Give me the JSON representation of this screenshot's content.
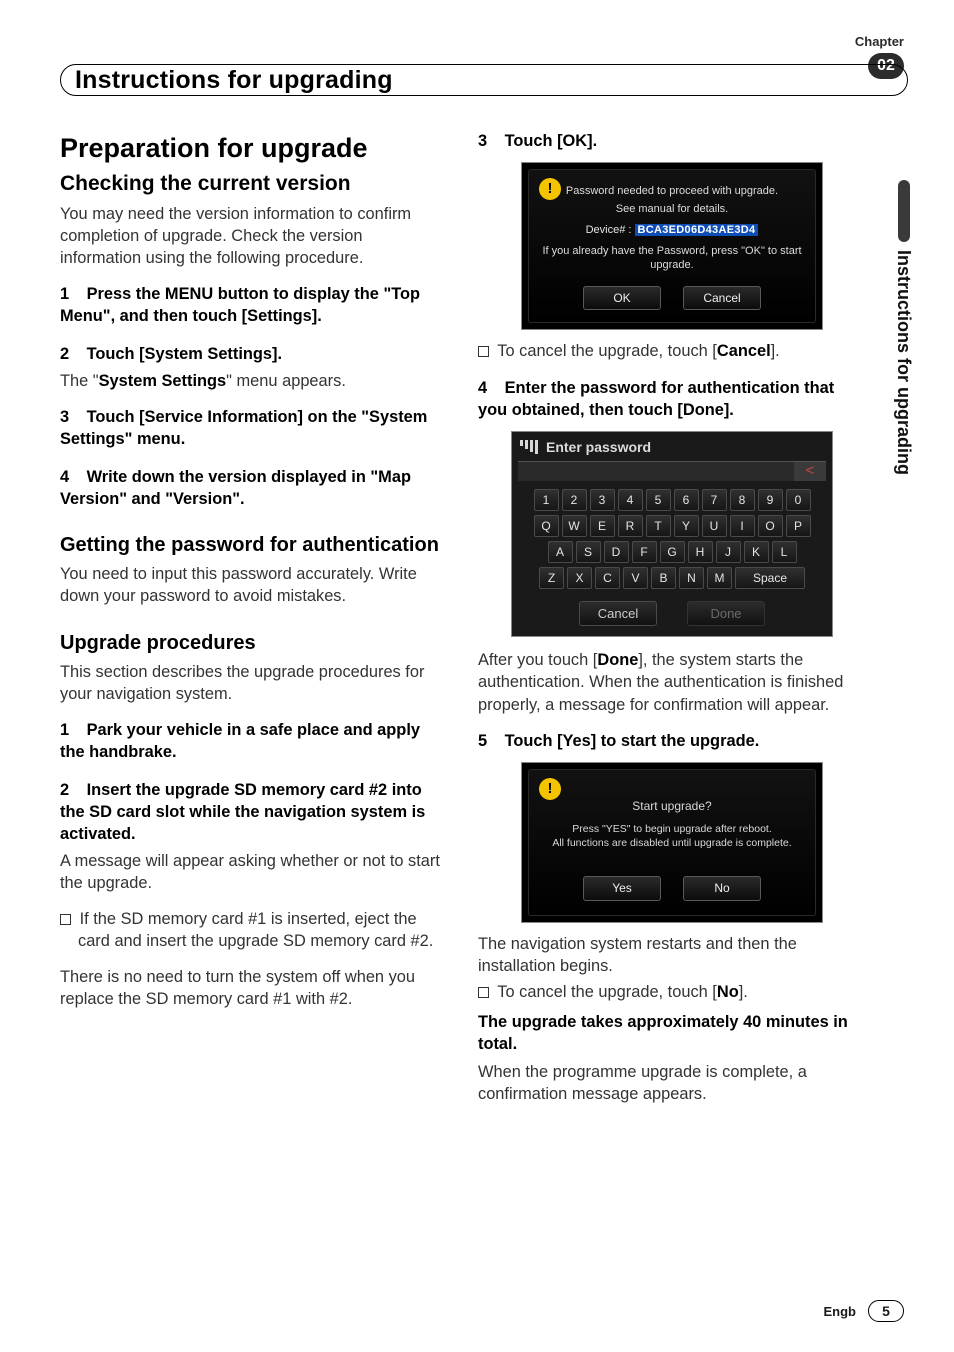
{
  "chapter": {
    "label": "Chapter",
    "number": "02"
  },
  "header": {
    "title": "Instructions for upgrading"
  },
  "sidetab": "Instructions for upgrading",
  "footer": {
    "lang": "Engb",
    "page": "5"
  },
  "left": {
    "h1": "Preparation for upgrade",
    "h2a": "Checking the current version",
    "p1": "You may need the version information to confirm completion of upgrade. Check the version information using the following procedure.",
    "s1_num": "1",
    "s1_txt": "Press the MENU button to display the \"Top Menu\", and then touch [Settings].",
    "s2_num": "2",
    "s2_txt": "Touch [System Settings].",
    "s2_body_a": "The \"",
    "s2_body_b": "System Settings",
    "s2_body_c": "\" menu appears.",
    "s3_num": "3",
    "s3_txt": "Touch [Service Information] on the \"System Settings\" menu.",
    "s4_num": "4",
    "s4_txt": "Write down the version displayed in \"Map Version\" and \"Version\".",
    "h2b": "Getting the password for authentication",
    "p2": "You need to input this password accurately. Write down your password to avoid mistakes.",
    "h2c": "Upgrade procedures",
    "p3": "This section describes the upgrade procedures for your navigation system.",
    "u1_num": "1",
    "u1_txt": "Park your vehicle in a safe place and apply the handbrake.",
    "u2_num": "2",
    "u2_txt": "Insert the upgrade SD memory card #2 into the SD card slot while the navigation system is activated.",
    "u2_body": "A message will appear asking whether or not to start the upgrade.",
    "u2_note1": "If the SD memory card #1 is inserted, eject the card and insert the upgrade SD memory card #2.",
    "u2_note2": "There is no need to turn the system off when you replace the SD memory card #1 with #2."
  },
  "right": {
    "s3_num": "3",
    "s3_txt": "Touch [OK].",
    "dlg1": {
      "line1": "Password  needed to proceed with upgrade.",
      "line2": "See manual for details.",
      "device_label": "Device# : ",
      "device_value": "BCA3ED06D43AE3D4",
      "line3": "If you already have the Password, press \"OK\" to start upgrade.",
      "ok": "OK",
      "cancel": "Cancel"
    },
    "note_cancel_a": "To cancel the upgrade, touch [",
    "note_cancel_b": "Cancel",
    "note_cancel_c": "].",
    "s4_num": "4",
    "s4_txt": "Enter the password for authentication that you obtained, then touch [Done].",
    "kbd": {
      "title": "Enter password",
      "rows": {
        "r1": [
          "1",
          "2",
          "3",
          "4",
          "5",
          "6",
          "7",
          "8",
          "9",
          "0"
        ],
        "r2": [
          "Q",
          "W",
          "E",
          "R",
          "T",
          "Y",
          "U",
          "I",
          "O",
          "P"
        ],
        "r3": [
          "A",
          "S",
          "D",
          "F",
          "G",
          "H",
          "J",
          "K",
          "L"
        ],
        "r4": [
          "Z",
          "X",
          "C",
          "V",
          "B",
          "N",
          "M"
        ]
      },
      "space": "Space",
      "cancel": "Cancel",
      "done": "Done"
    },
    "after_a": "After you touch [",
    "after_b": "Done",
    "after_c": "], the system starts the authentication. When the authentication is finished properly, a message for confirmation will appear.",
    "s5_num": "5",
    "s5_txt": "Touch [Yes] to start the upgrade.",
    "dlg2": {
      "line1": "Start upgrade?",
      "line2": "Press \"YES\" to begin upgrade after reboot.",
      "line3": "All functions are disabled until upgrade is complete.",
      "yes": "Yes",
      "no": "No"
    },
    "post1": "The navigation system restarts and then the installation begins.",
    "note_no_a": "To cancel the upgrade, touch [",
    "note_no_b": "No",
    "note_no_c": "].",
    "warn": "The upgrade takes approximately 40 minutes in total.",
    "post2": "When the programme upgrade is complete, a confirmation message appears."
  }
}
